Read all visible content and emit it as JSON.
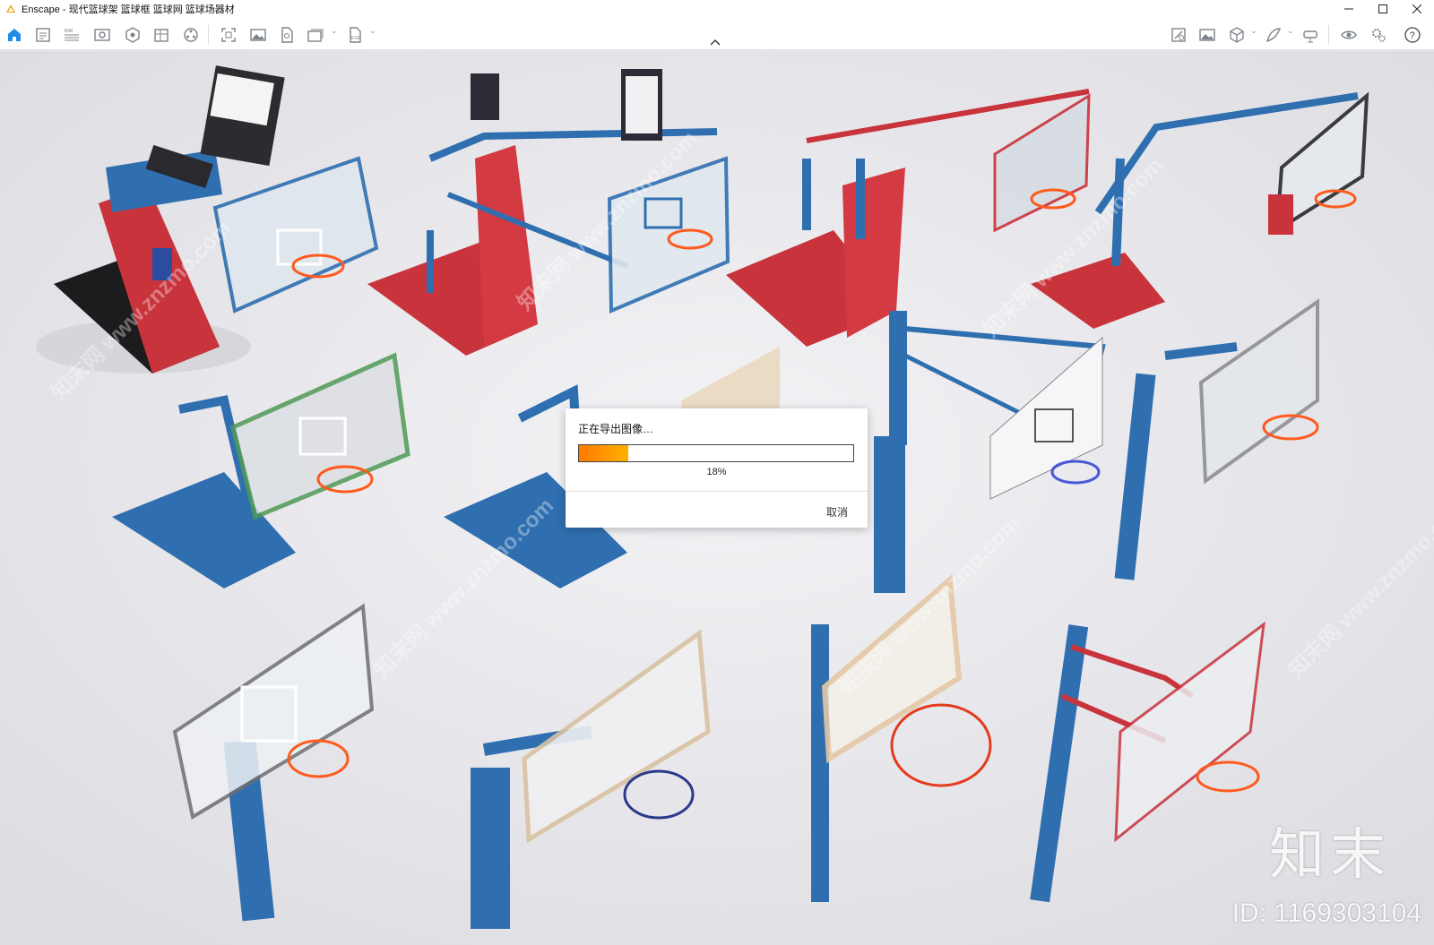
{
  "window": {
    "title": "Enscape - 现代篮球架 篮球框 篮球网 篮球场器材",
    "minimize_icon": "minimize-icon",
    "maximize_icon": "maximize-icon",
    "close_icon": "close-icon"
  },
  "toolbar": {
    "left_icons": [
      "home-icon",
      "assets-icon",
      "bim-icon",
      "views-icon",
      "sun-icon",
      "layers-icon",
      "objects-icon",
      "screenshot-icon",
      "image-icon",
      "export-pdf-icon",
      "batch-render-icon",
      "export-exe-icon"
    ],
    "right_icons": [
      "material-editor-icon",
      "image-gallery-icon",
      "cube-icon",
      "edit-icon",
      "vr-icon",
      "visual-settings-icon",
      "settings-icon",
      "help-icon"
    ],
    "collapse_icon": "chevron-up-icon",
    "help_label": "?"
  },
  "dialog": {
    "title": "正在导出图像…",
    "progress_label": "18%",
    "progress": 0.18,
    "cancel_label": "取消"
  },
  "watermark": {
    "brand": "知末",
    "id_text": "ID: 1169303104",
    "repeat_text": "知末网 www.znzmo.com"
  },
  "colors": {
    "accent": "#1f8ce6",
    "progress": "#ff8a00",
    "red": "#c9333b",
    "blue": "#2f6fb0"
  }
}
